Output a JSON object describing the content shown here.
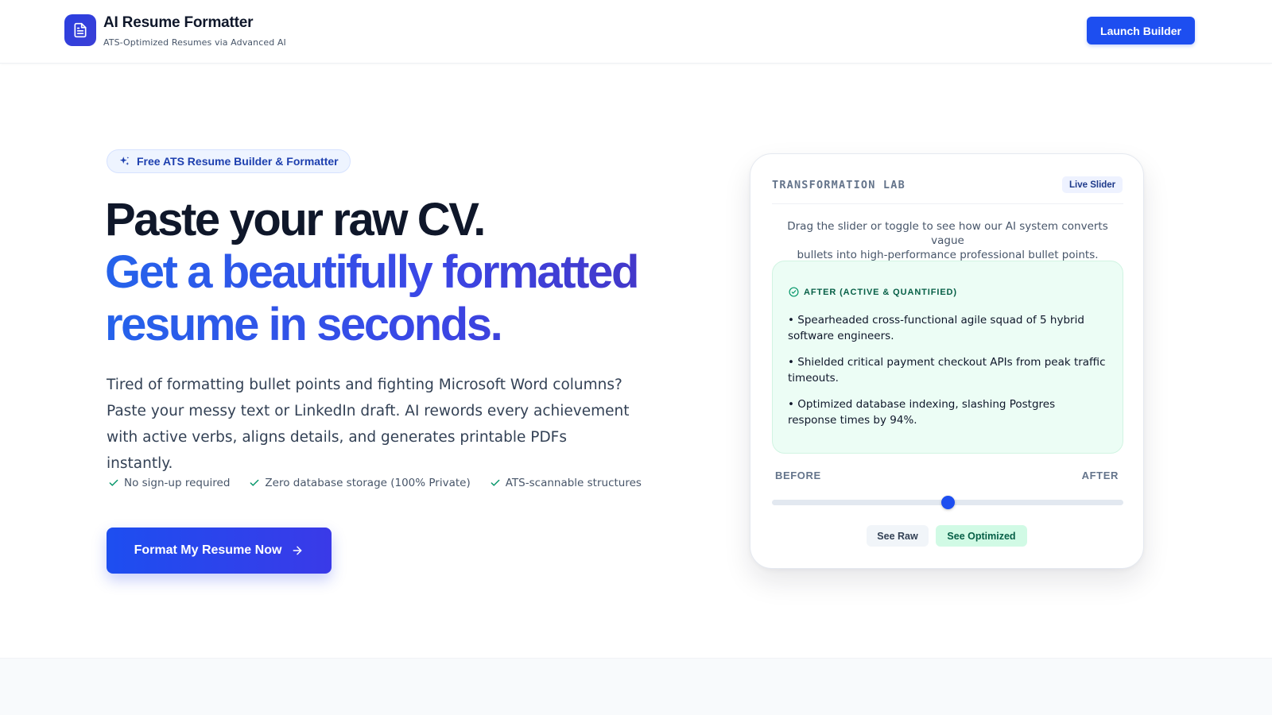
{
  "header": {
    "title": "AI Resume Formatter",
    "subtitle": "ATS-Optimized Resumes via Advanced AI",
    "logo_icon": "document-icon",
    "launch_label": "Launch Builder"
  },
  "hero": {
    "badge": "Free ATS Resume Builder & Formatter",
    "badge_icon": "sparkles-icon",
    "headline_line1": "Paste your raw CV.",
    "headline_line2": "Get a beautifully formatted",
    "headline_line3": "resume in seconds.",
    "lead_line1": "Tired of formatting bullet points and fighting Microsoft Word columns?",
    "lead_line2": "Paste your messy text or LinkedIn draft. AI rewords every achievement",
    "lead_line3": "with active verbs, aligns details, and generates printable PDFs instantly.",
    "checks": [
      "No sign-up required",
      "Zero database storage (100% Private)",
      "ATS-scannable structures"
    ],
    "cta_label": "Format My Resume Now",
    "cta_icon": "arrow-right-icon"
  },
  "lab": {
    "title": "TRANSFORMATION LAB",
    "badge": "Live Slider",
    "desc_line1": "Drag the slider or toggle to see how our AI system converts vague",
    "desc_line2": "bullets into high-performance professional bullet points.",
    "after_label": "AFTER (ACTIVE & QUANTIFIED)",
    "bullets": [
      "• Spearheaded cross-functional agile squad of 5 hybrid software engineers.",
      "• Shielded critical payment checkout APIs from peak traffic timeouts.",
      "• Optimized database indexing, slashing Postgres response times by 94%."
    ],
    "before_label": "BEFORE",
    "after_end_label": "AFTER",
    "slider_value": 0.5,
    "see_raw": "See Raw",
    "see_optimized": "See Optimized"
  },
  "colors": {
    "accent": "#1d4ef0",
    "success": "#059669",
    "success_bg": "#ecfdf5"
  }
}
